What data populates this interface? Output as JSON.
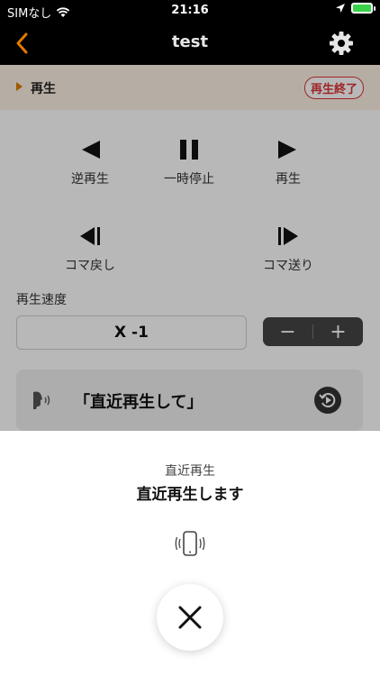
{
  "status": {
    "carrier": "SIMなし",
    "time": "21:16"
  },
  "nav": {
    "title": "test"
  },
  "playback": {
    "label": "再生",
    "end_label": "再生終了"
  },
  "controls": {
    "reverse": "逆再生",
    "pause": "一時停止",
    "play": "再生",
    "frame_back": "コマ戻し",
    "frame_forward": "コマ送り"
  },
  "speed": {
    "label": "再生速度",
    "value": "X -1",
    "minus": "−",
    "plus": "+"
  },
  "voice": {
    "text": "「直近再生して」"
  },
  "sheet": {
    "caption": "直近再生",
    "message": "直近再生します"
  },
  "colors": {
    "accent": "#e07b00",
    "danger": "#dd3333"
  }
}
